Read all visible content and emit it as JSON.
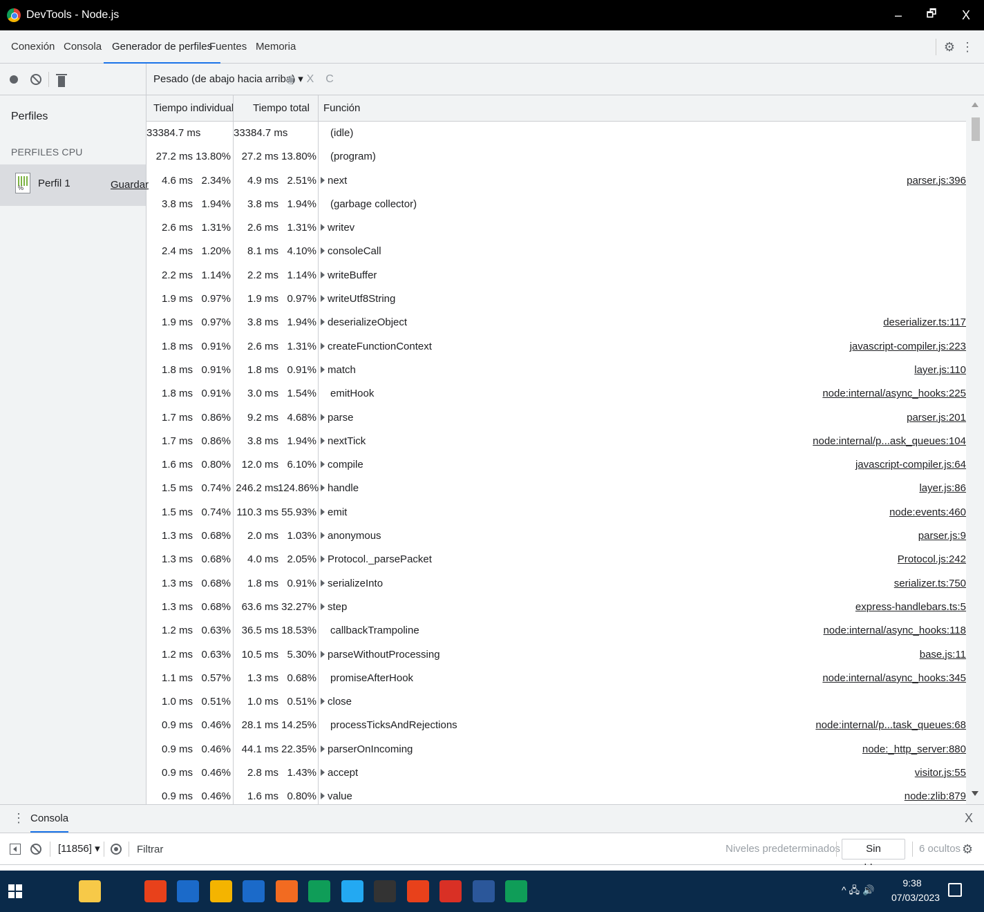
{
  "window": {
    "title": "DevTools - Node.js",
    "minimize": "–",
    "restore": "🗗",
    "close": "X"
  },
  "tabs": [
    {
      "label": "Conexión"
    },
    {
      "label": "Consola"
    },
    {
      "label": "Generador de perfiles",
      "active": true
    },
    {
      "label": "Fuentes"
    },
    {
      "label": "Memoria"
    }
  ],
  "toolbar": {
    "view_select": "Pesado (de abajo hacia arriba) ▾",
    "focus_icon": "◉",
    "clear_icon": "X",
    "reload_icon": "C"
  },
  "sidebar": {
    "heading": "Perfiles",
    "section": "PERFILES CPU",
    "profile": {
      "name": "Perfil 1",
      "save": "Guardar"
    }
  },
  "grid": {
    "columns": {
      "self": "Tiempo individual",
      "total": "Tiempo total",
      "function": "Función"
    },
    "rows": [
      {
        "self": "33384.7 ms",
        "self_pct": "",
        "total": "33384.7 ms",
        "total_pct": "",
        "expand": false,
        "fn": "(idle)",
        "url": ""
      },
      {
        "self": "27.2 ms",
        "self_pct": "13.80%",
        "total": "27.2 ms",
        "total_pct": "13.80%",
        "expand": false,
        "fn": "(program)",
        "url": ""
      },
      {
        "self": "4.6 ms",
        "self_pct": "2.34%",
        "total": "4.9 ms",
        "total_pct": "2.51%",
        "expand": true,
        "fn": "next",
        "url": "parser.js:396"
      },
      {
        "self": "3.8 ms",
        "self_pct": "1.94%",
        "total": "3.8 ms",
        "total_pct": "1.94%",
        "expand": false,
        "fn": "(garbage collector)",
        "url": ""
      },
      {
        "self": "2.6 ms",
        "self_pct": "1.31%",
        "total": "2.6 ms",
        "total_pct": "1.31%",
        "expand": true,
        "fn": "writev",
        "url": ""
      },
      {
        "self": "2.4 ms",
        "self_pct": "1.20%",
        "total": "8.1 ms",
        "total_pct": "4.10%",
        "expand": true,
        "fn": "consoleCall",
        "url": ""
      },
      {
        "self": "2.2 ms",
        "self_pct": "1.14%",
        "total": "2.2 ms",
        "total_pct": "1.14%",
        "expand": true,
        "fn": "writeBuffer",
        "url": ""
      },
      {
        "self": "1.9 ms",
        "self_pct": "0.97%",
        "total": "1.9 ms",
        "total_pct": "0.97%",
        "expand": true,
        "fn": "writeUtf8String",
        "url": ""
      },
      {
        "self": "1.9 ms",
        "self_pct": "0.97%",
        "total": "3.8 ms",
        "total_pct": "1.94%",
        "expand": true,
        "fn": "deserializeObject",
        "url": "deserializer.ts:117"
      },
      {
        "self": "1.8 ms",
        "self_pct": "0.91%",
        "total": "2.6 ms",
        "total_pct": "1.31%",
        "expand": true,
        "fn": "createFunctionContext",
        "url": "javascript-compiler.js:223"
      },
      {
        "self": "1.8 ms",
        "self_pct": "0.91%",
        "total": "1.8 ms",
        "total_pct": "0.91%",
        "expand": true,
        "fn": "match",
        "url": "layer.js:110"
      },
      {
        "self": "1.8 ms",
        "self_pct": "0.91%",
        "total": "3.0 ms",
        "total_pct": "1.54%",
        "expand": false,
        "fn": "emitHook",
        "url": "node:internal/async_hooks:225"
      },
      {
        "self": "1.7 ms",
        "self_pct": "0.86%",
        "total": "9.2 ms",
        "total_pct": "4.68%",
        "expand": true,
        "fn": "parse",
        "url": "parser.js:201"
      },
      {
        "self": "1.7 ms",
        "self_pct": "0.86%",
        "total": "3.8 ms",
        "total_pct": "1.94%",
        "expand": true,
        "fn": "nextTick",
        "url": "node:internal/p...ask_queues:104"
      },
      {
        "self": "1.6 ms",
        "self_pct": "0.80%",
        "total": "12.0 ms",
        "total_pct": "6.10%",
        "expand": true,
        "fn": "compile",
        "url": "javascript-compiler.js:64"
      },
      {
        "self": "1.5 ms",
        "self_pct": "0.74%",
        "total": "246.2 ms",
        "total_pct": "124.86%",
        "expand": true,
        "fn": "handle",
        "url": "layer.js:86"
      },
      {
        "self": "1.5 ms",
        "self_pct": "0.74%",
        "total": "110.3 ms",
        "total_pct": "55.93%",
        "expand": true,
        "fn": "emit",
        "url": "node:events:460"
      },
      {
        "self": "1.3 ms",
        "self_pct": "0.68%",
        "total": "2.0 ms",
        "total_pct": "1.03%",
        "expand": true,
        "fn": "anonymous",
        "url": "parser.js:9"
      },
      {
        "self": "1.3 ms",
        "self_pct": "0.68%",
        "total": "4.0 ms",
        "total_pct": "2.05%",
        "expand": true,
        "fn": "Protocol._parsePacket",
        "url": "Protocol.js:242"
      },
      {
        "self": "1.3 ms",
        "self_pct": "0.68%",
        "total": "1.8 ms",
        "total_pct": "0.91%",
        "expand": true,
        "fn": "serializeInto",
        "url": "serializer.ts:750"
      },
      {
        "self": "1.3 ms",
        "self_pct": "0.68%",
        "total": "63.6 ms",
        "total_pct": "32.27%",
        "expand": true,
        "fn": "step",
        "url": "express-handlebars.ts:5"
      },
      {
        "self": "1.2 ms",
        "self_pct": "0.63%",
        "total": "36.5 ms",
        "total_pct": "18.53%",
        "expand": false,
        "fn": "callbackTrampoline",
        "url": "node:internal/async_hooks:118"
      },
      {
        "self": "1.2 ms",
        "self_pct": "0.63%",
        "total": "10.5 ms",
        "total_pct": "5.30%",
        "expand": true,
        "fn": "parseWithoutProcessing",
        "url": "base.js:11"
      },
      {
        "self": "1.1 ms",
        "self_pct": "0.57%",
        "total": "1.3 ms",
        "total_pct": "0.68%",
        "expand": false,
        "fn": "promiseAfterHook",
        "url": "node:internal/async_hooks:345"
      },
      {
        "self": "1.0 ms",
        "self_pct": "0.51%",
        "total": "1.0 ms",
        "total_pct": "0.51%",
        "expand": true,
        "fn": "close",
        "url": ""
      },
      {
        "self": "0.9 ms",
        "self_pct": "0.46%",
        "total": "28.1 ms",
        "total_pct": "14.25%",
        "expand": false,
        "fn": "processTicksAndRejections",
        "url": "node:internal/p...task_queues:68"
      },
      {
        "self": "0.9 ms",
        "self_pct": "0.46%",
        "total": "44.1 ms",
        "total_pct": "22.35%",
        "expand": true,
        "fn": "parserOnIncoming",
        "url": "node:_http_server:880"
      },
      {
        "self": "0.9 ms",
        "self_pct": "0.46%",
        "total": "2.8 ms",
        "total_pct": "1.43%",
        "expand": true,
        "fn": "accept",
        "url": "visitor.js:55"
      },
      {
        "self": "0.9 ms",
        "self_pct": "0.46%",
        "total": "1.6 ms",
        "total_pct": "0.80%",
        "expand": true,
        "fn": "value",
        "url": "node:zlib:879"
      }
    ]
  },
  "drawer": {
    "tab": "Consola",
    "close": "X"
  },
  "console_toolbar": {
    "context": "[11856] ▾",
    "filter_placeholder": "Filtrar",
    "levels": "Niveles predeterminados ▾",
    "issues": "Sin problemas",
    "hidden": "6 ocultos"
  },
  "taskbar": {
    "apps": [
      {
        "icon": "task-view-icon",
        "color": "#0a2a4a"
      },
      {
        "icon": "file-explorer-icon",
        "color": "#f7c948"
      },
      {
        "icon": "app-icon",
        "color": "#0a2a4a"
      },
      {
        "icon": "app-icon",
        "color": "#e8411b"
      },
      {
        "icon": "app-icon",
        "color": "#1b6ac9"
      },
      {
        "icon": "chrome-icon",
        "color": "#f4b400"
      },
      {
        "icon": "app-icon",
        "color": "#1b6ac9"
      },
      {
        "icon": "app-icon",
        "color": "#f26b21"
      },
      {
        "icon": "chrome-icon",
        "color": "#0f9d58"
      },
      {
        "icon": "vscode-icon",
        "color": "#23a9f2"
      },
      {
        "icon": "terminal-icon",
        "color": "#333"
      },
      {
        "icon": "app-icon",
        "color": "#e8411b"
      },
      {
        "icon": "acrobat-icon",
        "color": "#d93025"
      },
      {
        "icon": "word-icon",
        "color": "#2b579a"
      },
      {
        "icon": "chrome-icon",
        "color": "#0f9d58"
      }
    ],
    "tray": "^ 🖧 🔊",
    "time": "9:38",
    "date": "07/03/2023"
  },
  "colors": {
    "accent": "#1a73e8",
    "panel": "#f1f3f4",
    "taskbar": "#0a2a4a"
  }
}
